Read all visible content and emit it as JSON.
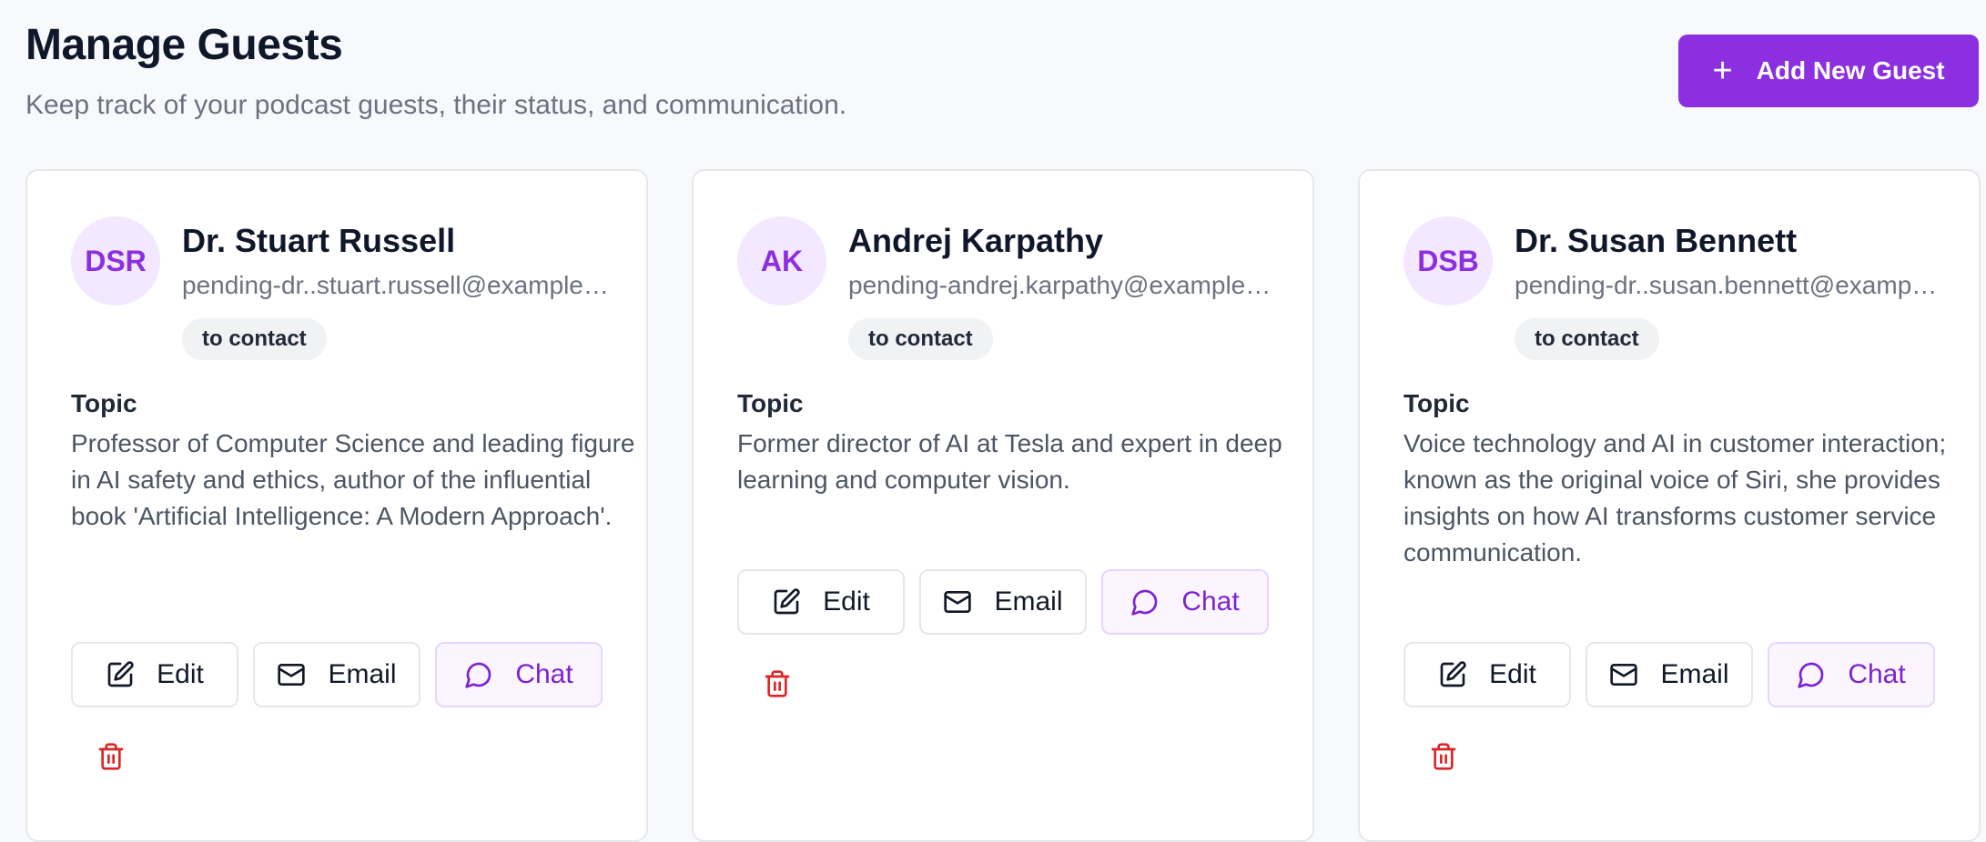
{
  "header": {
    "title": "Manage Guests",
    "subtitle": "Keep track of your podcast guests, their status, and communication."
  },
  "add_button": {
    "icon": "plus-icon",
    "label": "Add New Guest"
  },
  "colors": {
    "accent": "#8b2fe0",
    "avatar_bg": "#f3e8ff",
    "delete": "#dc2626",
    "chat_bg": "#faf5ff"
  },
  "labels": {
    "topic": "Topic",
    "edit": "Edit",
    "email": "Email",
    "chat": "Chat"
  },
  "guests": [
    {
      "initials": "DSR",
      "name": "Dr. Stuart Russell",
      "email": "pending-dr..stuart.russell@example.com",
      "status": "to contact",
      "topic": "Professor of Computer Science and leading figure in AI safety and ethics, author of the influential book 'Artificial Intelligence: A Modern Approach'."
    },
    {
      "initials": "AK",
      "name": "Andrej Karpathy",
      "email": "pending-andrej.karpathy@example.com",
      "status": "to contact",
      "topic": "Former director of AI at Tesla and expert in deep learning and computer vision."
    },
    {
      "initials": "DSB",
      "name": "Dr. Susan Bennett",
      "email": "pending-dr..susan.bennett@example.com",
      "status": "to contact",
      "topic": "Voice technology and AI in customer interaction; known as the original voice of Siri, she provides insights on how AI transforms customer service communication."
    }
  ]
}
